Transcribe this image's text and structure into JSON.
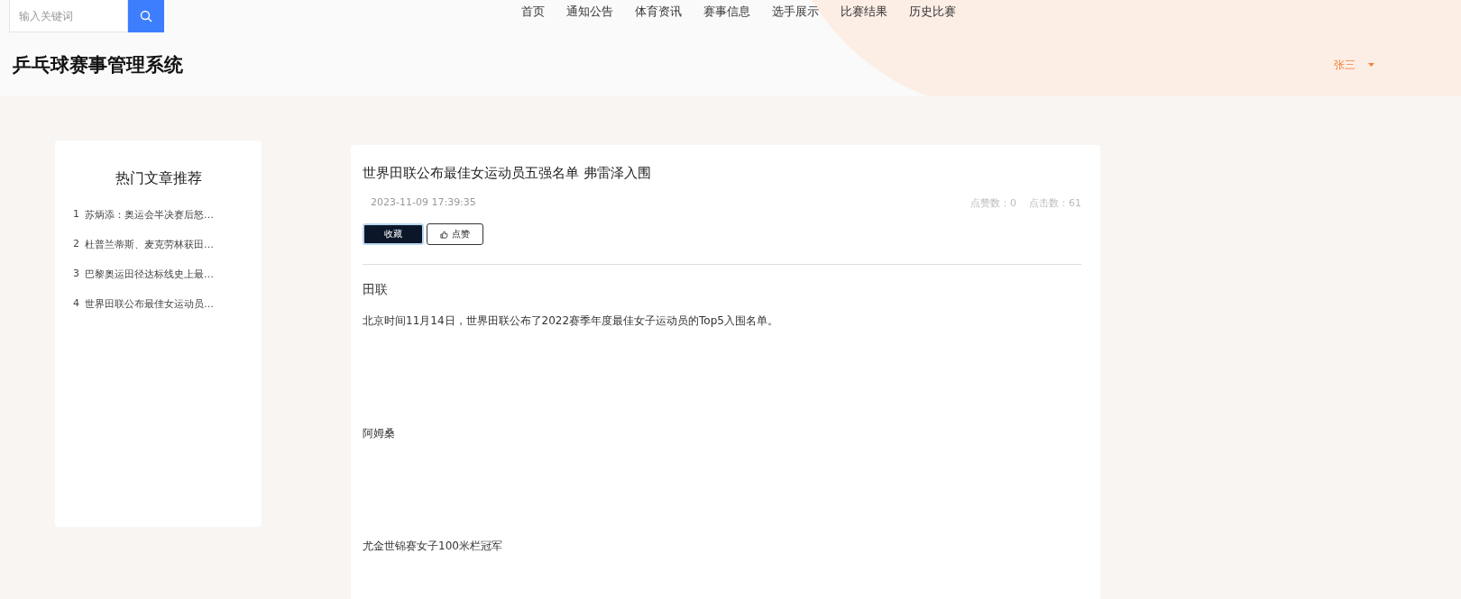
{
  "search": {
    "placeholder": "输入关键词"
  },
  "nav": [
    "首页",
    "通知公告",
    "体育资讯",
    "赛事信息",
    "选手展示",
    "比赛结果",
    "历史比赛"
  ],
  "site_title": "乒乓球赛事管理系统",
  "user": {
    "name": "张三"
  },
  "hot_articles": {
    "title": "热门文章推荐",
    "items": [
      {
        "rank": "1",
        "title": "苏炳添：奥运会半决赛后怒…"
      },
      {
        "rank": "2",
        "title": "杜普兰蒂斯、麦克劳林获田…"
      },
      {
        "rank": "3",
        "title": "巴黎奥运田径达标线史上最…"
      },
      {
        "rank": "4",
        "title": "世界田联公布最佳女运动员…"
      }
    ]
  },
  "article": {
    "title": "世界田联公布最佳女运动员五强名单 弗雷泽入围",
    "date": "2023-11-09 17:39:35",
    "stats": [
      "点赞数：0",
      "点击数：61"
    ],
    "buttons": [
      {
        "label": "收藏",
        "kind": "primary"
      },
      {
        "label": "点赞",
        "kind": "outline"
      }
    ],
    "body": [
      {
        "kind": "heading",
        "text": "田联"
      },
      {
        "kind": "text",
        "text": "北京时间11月14日，世界田联公布了2022赛季年度最佳女子运动员的Top5入围名单。"
      },
      {
        "kind": "text",
        "text": "阿姆桑"
      },
      {
        "kind": "text",
        "text": "尤金世锦赛女子100米栏冠军"
      }
    ]
  }
}
